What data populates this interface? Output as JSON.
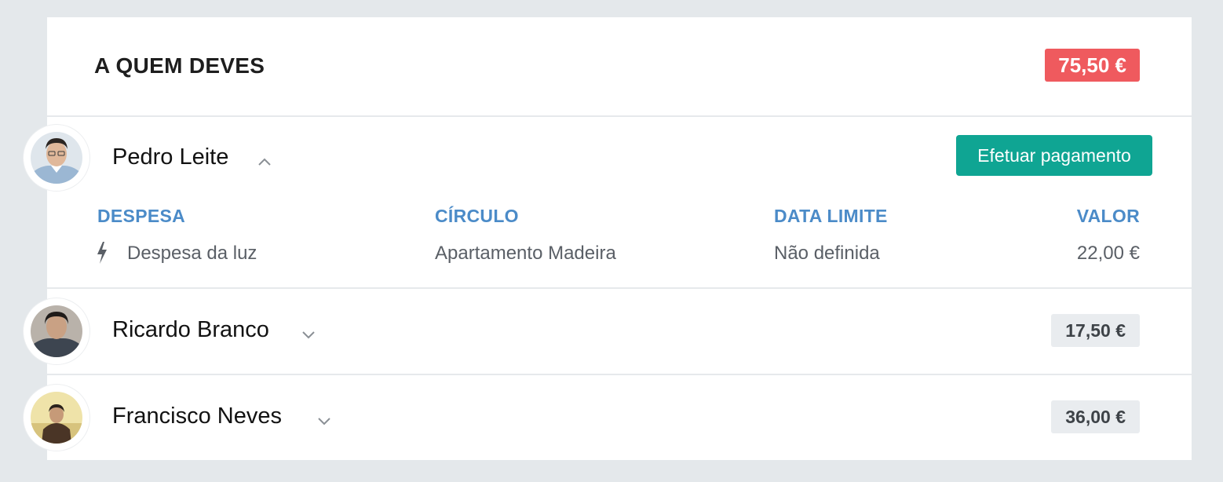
{
  "header": {
    "title": "A QUEM DEVES",
    "total": "75,50 €",
    "total_color": "#ef5a5e"
  },
  "people": [
    {
      "name": "Pedro Leite",
      "expanded": true,
      "chevron_icon": "chevron-up-icon",
      "action_label": "Efetuar pagamento",
      "table": {
        "columns": [
          "DESPESA",
          "CÍRCULO",
          "DATA LIMITE",
          "VALOR"
        ],
        "rows": [
          {
            "icon": "bolt-icon",
            "despesa": "Despesa da luz",
            "circulo": "Apartamento Madeira",
            "data_limite": "Não definida",
            "valor": "22,00 €"
          }
        ]
      }
    },
    {
      "name": "Ricardo Branco",
      "expanded": false,
      "chevron_icon": "chevron-down-icon",
      "amount": "17,50 €"
    },
    {
      "name": "Francisco Neves",
      "expanded": false,
      "chevron_icon": "chevron-down-icon",
      "amount": "36,00 €"
    }
  ],
  "colors": {
    "accent_button": "#0fa593",
    "column_header": "#4b8bc8",
    "page_background": "#e4e8eb"
  }
}
